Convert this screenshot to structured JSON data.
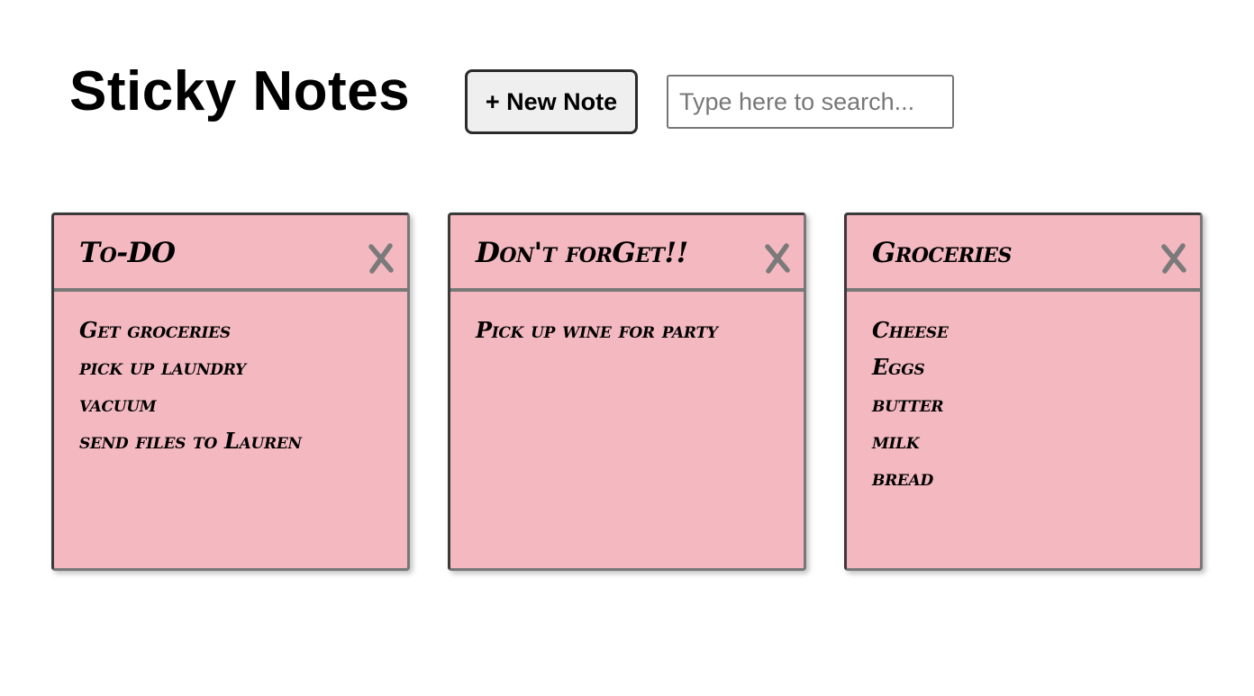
{
  "header": {
    "title": "Sticky Notes",
    "new_note_label": "+ New Note",
    "search_placeholder": "Type here to search...",
    "search_value": ""
  },
  "colors": {
    "note_background": "#f4b8c0",
    "note_border": "#787878",
    "close_icon": "#7a7a7a",
    "button_background": "#efefef"
  },
  "icons": {
    "close": "close-icon"
  },
  "notes": [
    {
      "title": "To-DO",
      "lines": [
        "Get groceries",
        "pick up laundry",
        "vacuum",
        "send files to Lauren"
      ]
    },
    {
      "title": "Don't forGet!!",
      "lines": [
        "Pick up wine for party"
      ]
    },
    {
      "title": "Groceries",
      "lines": [
        "Cheese",
        "Eggs",
        "butter",
        "milk",
        "bread"
      ]
    }
  ]
}
